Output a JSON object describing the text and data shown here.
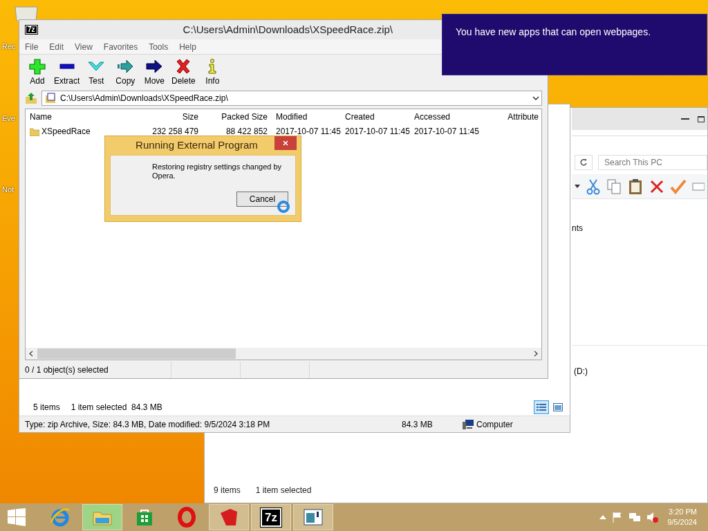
{
  "desktop": {
    "icons": [
      {
        "label": "Rec"
      },
      {
        "label": "Eve"
      },
      {
        "label": "Not"
      }
    ]
  },
  "explorer_back": {
    "search": {
      "placeholder": "Search This PC"
    },
    "items": [
      {
        "label": "nts"
      },
      {
        "label": "(D:)"
      }
    ],
    "status": {
      "count": "9 items",
      "selection": "1 item selected"
    }
  },
  "explorer_front": {
    "status": {
      "count": "5 items",
      "selection": "1 item selected",
      "size": "84.3 MB"
    },
    "view_buttons": [
      {
        "kind": "details",
        "selected": true
      },
      {
        "kind": "tiles",
        "selected": false
      }
    ],
    "details": {
      "info": "Type: zip Archive, Size: 84.3 MB, Date modified: 9/5/2024 3:18 PM",
      "size": "84.3 MB",
      "location": "Computer"
    }
  },
  "archive_window": {
    "logo": "7z",
    "title": "C:\\Users\\Admin\\Downloads\\XSpeedRace.zip\\",
    "menu": [
      "File",
      "Edit",
      "View",
      "Favorites",
      "Tools",
      "Help"
    ],
    "toolbar": [
      {
        "label": "Add",
        "kind": "add"
      },
      {
        "label": "Extract",
        "kind": "extract"
      },
      {
        "label": "Test",
        "kind": "test"
      },
      {
        "label": "Copy",
        "kind": "copy"
      },
      {
        "label": "Move",
        "kind": "move"
      },
      {
        "label": "Delete",
        "kind": "delete"
      },
      {
        "label": "Info",
        "kind": "info"
      }
    ],
    "path": "C:\\Users\\Admin\\Downloads\\XSpeedRace.zip\\",
    "columns": [
      "Name",
      "Size",
      "Packed Size",
      "Modified",
      "Created",
      "Accessed",
      "Attribute"
    ],
    "rows": [
      {
        "selected": false,
        "cells": [
          "XSpeedRace",
          "232 258 479",
          "88 422 852",
          "2017-10-07 11:45",
          "2017-10-07 11:45",
          "2017-10-07 11:45"
        ]
      }
    ],
    "status": [
      "0 / 1 object(s) selected"
    ]
  },
  "dialog": {
    "title": "Running External Program",
    "message": "Restoring registry settings changed by Opera.",
    "buttons": [
      "Cancel"
    ]
  },
  "notification": {
    "text": "You have new apps that can open webpages."
  },
  "taskbar": {
    "apps": [
      {
        "kind": "ie",
        "open": false,
        "selected": false
      },
      {
        "kind": "explorer",
        "open": true,
        "selected": true
      },
      {
        "kind": "store",
        "open": false,
        "selected": false
      },
      {
        "kind": "opera",
        "open": false,
        "selected": false
      },
      {
        "kind": "redapp",
        "open": true,
        "selected": false
      },
      {
        "kind": "sevenzip",
        "open": true,
        "selected": false,
        "text": "7z"
      },
      {
        "kind": "window",
        "open": true,
        "selected": false
      }
    ],
    "clock": {
      "time": "3:20 PM",
      "date": "9/5/2024"
    }
  }
}
